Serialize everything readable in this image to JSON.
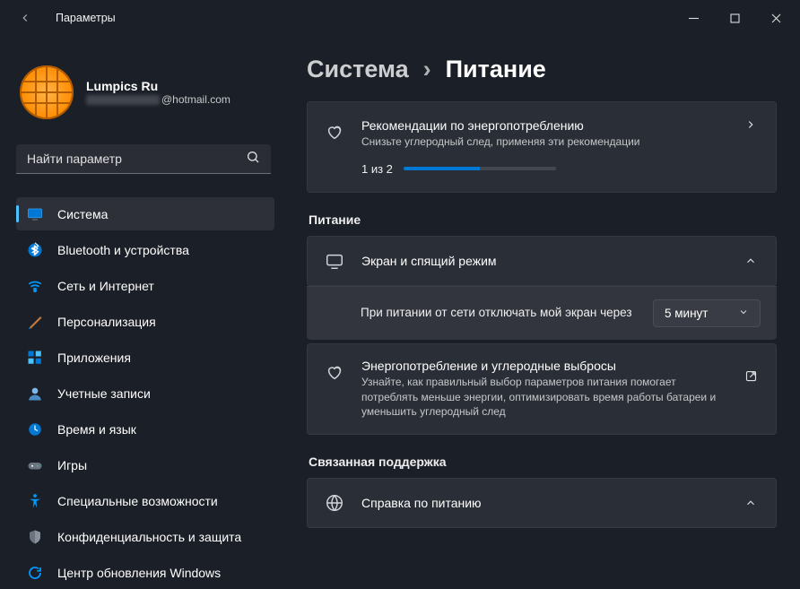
{
  "window": {
    "title": "Параметры"
  },
  "profile": {
    "name": "Lumpics Ru",
    "email_suffix": "@hotmail.com"
  },
  "search": {
    "placeholder": "Найти параметр"
  },
  "sidebar": {
    "items": [
      {
        "id": "system",
        "label": "Система"
      },
      {
        "id": "bluetooth",
        "label": "Bluetooth и устройства"
      },
      {
        "id": "network",
        "label": "Сеть и Интернет"
      },
      {
        "id": "personalization",
        "label": "Персонализация"
      },
      {
        "id": "apps",
        "label": "Приложения"
      },
      {
        "id": "accounts",
        "label": "Учетные записи"
      },
      {
        "id": "time",
        "label": "Время и язык"
      },
      {
        "id": "gaming",
        "label": "Игры"
      },
      {
        "id": "accessibility",
        "label": "Специальные возможности"
      },
      {
        "id": "privacy",
        "label": "Конфиденциальность и защита"
      },
      {
        "id": "update",
        "label": "Центр обновления Windows"
      }
    ]
  },
  "breadcrumb": {
    "parent": "Система",
    "sep": "›",
    "current": "Питание"
  },
  "recommend": {
    "title": "Рекомендации по энергопотреблению",
    "subtitle": "Снизьте углеродный след, применяя эти рекомендации",
    "progress_label": "1 из 2",
    "progress_pct": 50
  },
  "sections": {
    "power": {
      "title": "Питание",
      "screen_sleep": {
        "title": "Экран и спящий режим"
      },
      "turn_off_screen": {
        "label": "При питании от сети отключать мой экран через",
        "value": "5 минут"
      },
      "energy_carbon": {
        "title": "Энергопотребление и углеродные выбросы",
        "subtitle": "Узнайте, как правильный выбор параметров питания помогает потреблять меньше энергии, оптимизировать время работы батареи и уменьшить углеродный след"
      }
    },
    "related": {
      "title": "Связанная поддержка",
      "help": {
        "title": "Справка по питанию"
      }
    }
  }
}
